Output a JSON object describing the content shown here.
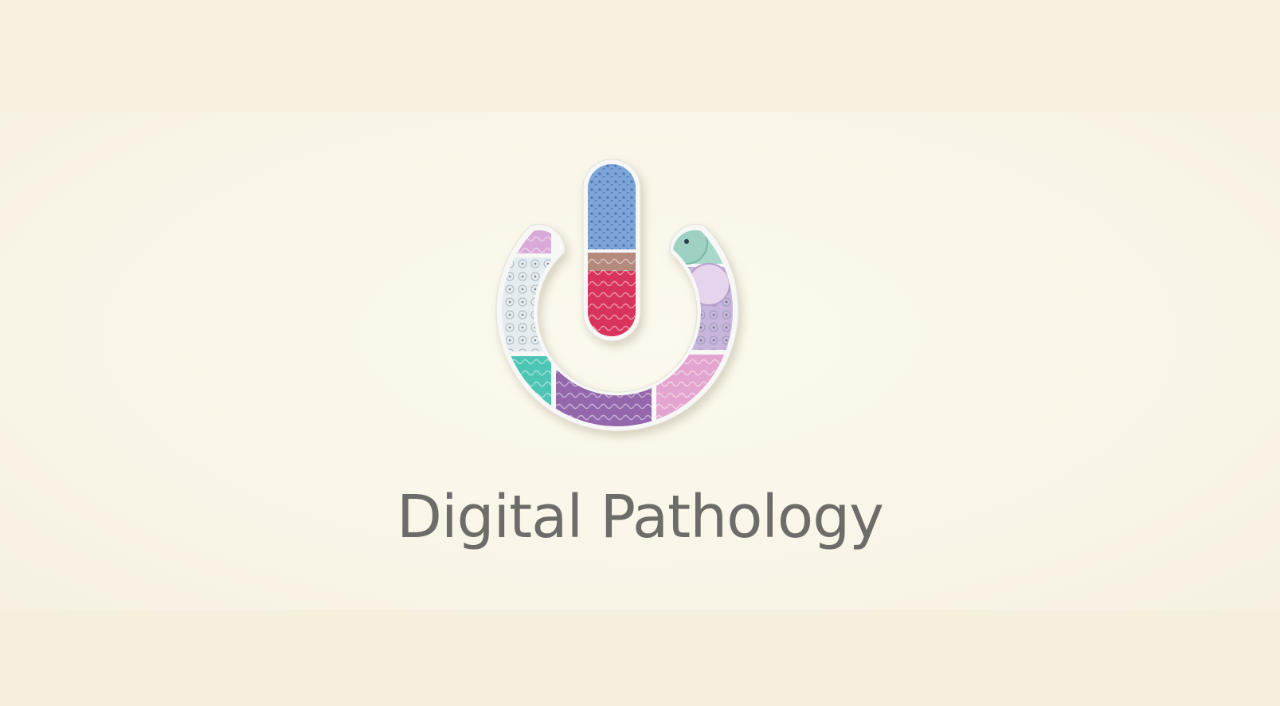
{
  "title": "Digital Pathology",
  "logo": {
    "icon": "power-button-icon",
    "tiles": [
      {
        "name": "tile-blue-cells",
        "color": "#7aa6d8"
      },
      {
        "name": "tile-red-tissue",
        "color": "#d8335c"
      },
      {
        "name": "tile-pink-top-left",
        "color": "#d9a9d8"
      },
      {
        "name": "tile-white-cells",
        "color": "#e4ecf0"
      },
      {
        "name": "tile-teal",
        "color": "#4cc5b4"
      },
      {
        "name": "tile-purple-bottom",
        "color": "#7e79c8"
      },
      {
        "name": "tile-pink-bottom-right",
        "color": "#e3a4cf"
      },
      {
        "name": "tile-lavender-right",
        "color": "#c7b5dc"
      },
      {
        "name": "tile-mint-top-right",
        "color": "#a8d8cc"
      }
    ]
  },
  "colors": {
    "background": "#f8f4e7",
    "title": "#6e6c68",
    "frame": "#f7f7f5"
  }
}
